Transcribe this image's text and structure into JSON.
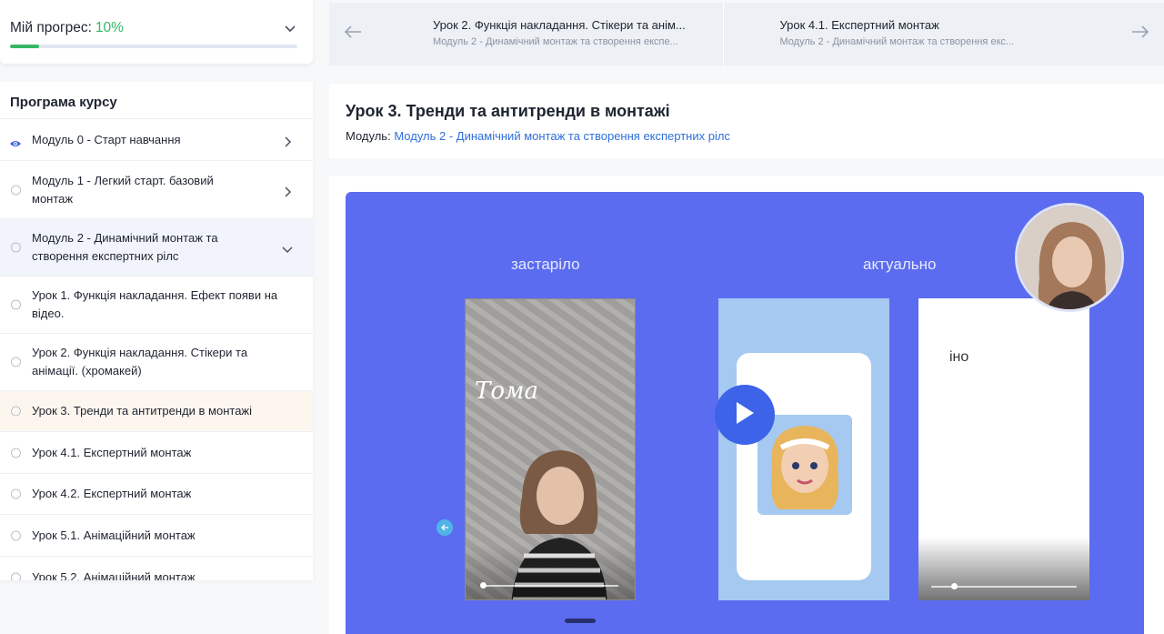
{
  "progress": {
    "label": "Мій прогрес:",
    "percent_text": "10%",
    "value": 0.1
  },
  "course": {
    "title": "Програма курсу",
    "items": [
      {
        "label": "Модуль 0 - Старт навчання",
        "type": "module",
        "state": "viewed"
      },
      {
        "label": "Модуль 1 - Легкий старт. базовий монтаж",
        "type": "module",
        "state": "collapsed"
      },
      {
        "label": "Модуль 2 - Динамічний монтаж та створення експертних рілс",
        "type": "module",
        "state": "expanded"
      },
      {
        "label": "Урок 1. Функція накладання. Ефект появи на відео.",
        "type": "lesson"
      },
      {
        "label": "Урок 2. Функція накладання. Стікери та анімації. (хромакей)",
        "type": "lesson"
      },
      {
        "label": "Урок 3. Тренди та антитренди в монтажі",
        "type": "lesson",
        "state": "current"
      },
      {
        "label": "Урок 4.1. Експертний монтаж",
        "type": "lesson"
      },
      {
        "label": "Урок 4.2. Експертний монтаж",
        "type": "lesson"
      },
      {
        "label": "Урок 5.1. Анімаційний монтаж",
        "type": "lesson"
      },
      {
        "label": "Урок 5.2. Анімаційний монтаж",
        "type": "lesson"
      }
    ]
  },
  "nav": {
    "prev": {
      "title": "Урок 2. Функція накладання. Стікери та анім...",
      "subtitle": "Модуль 2 - Динамічний монтаж та створення експе..."
    },
    "next": {
      "title": "Урок 4.1. Експертний монтаж",
      "subtitle": "Модуль 2 - Динамічний монтаж та створення екс..."
    }
  },
  "lesson": {
    "title": "Урок 3. Тренди та антитренди в монтажі",
    "module_label": "Модуль:",
    "module_link": "Модуль 2 - Динамічний монтаж та створення експертних рілс"
  },
  "video": {
    "label_left": "застаріло",
    "label_right": "актуально",
    "scribble_text": "Тома",
    "right_phone_text": "іно",
    "icons": [
      "play-icon",
      "back-arrow-icon"
    ]
  },
  "colors": {
    "accent": "#2f6fdc",
    "progress": "#34b866",
    "video_bg": "#5b6cf0",
    "play": "#3d63e8"
  }
}
